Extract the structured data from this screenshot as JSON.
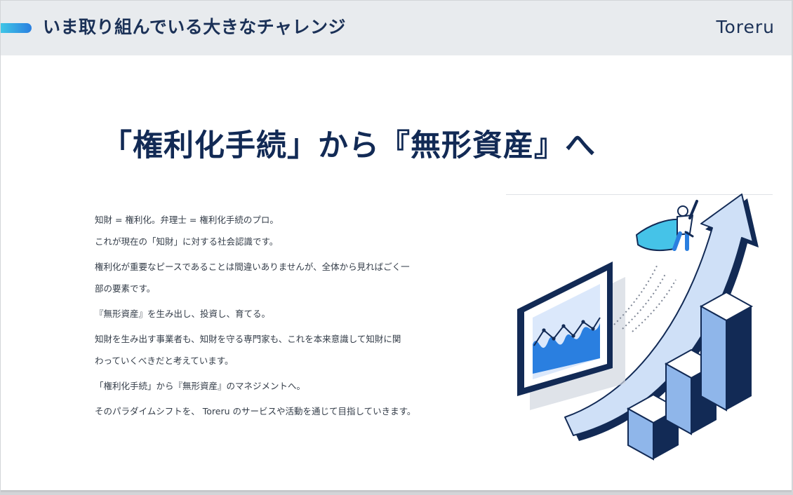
{
  "header": {
    "title": "いま取り組んでいる大きなチャレンジ",
    "logo": "Toreru"
  },
  "main": {
    "title": "「権利化手続」から『無形資産』へ",
    "paragraphs": [
      "知財 = 権利化。弁理士 = 権利化手続のプロ。",
      "これが現在の「知財」に対する社会認識です。",
      "権利化が重要なピースであることは間違いありませんが、全体から見ればごく一",
      "部の要素です。",
      "『無形資産』を生み出し、投資し、育てる。",
      "知財を生み出す事業者も、知財を守る専門家も、これを本来意識して知財に関",
      "わっていくべきだと考えています。",
      "「権利化手続」から『無形資産』のマネジメントへ。",
      "そのパラダイムシフトを、 Toreru のサービスや活動を通じて目指していきます。"
    ]
  },
  "colors": {
    "navy": "#122a55",
    "header_bg": "#e8ebee",
    "accent_start": "#3fc6e6",
    "accent_end": "#2a7fe0",
    "light_blue": "#cfe0f7",
    "mid_blue": "#8fb6ea",
    "bright_blue": "#2a7fe0",
    "cape": "#45c3e8"
  },
  "illustration": {
    "icons": [
      "growth-arrow-icon",
      "bar-chart-icon",
      "monitor-chart-icon",
      "superhero-icon"
    ]
  }
}
